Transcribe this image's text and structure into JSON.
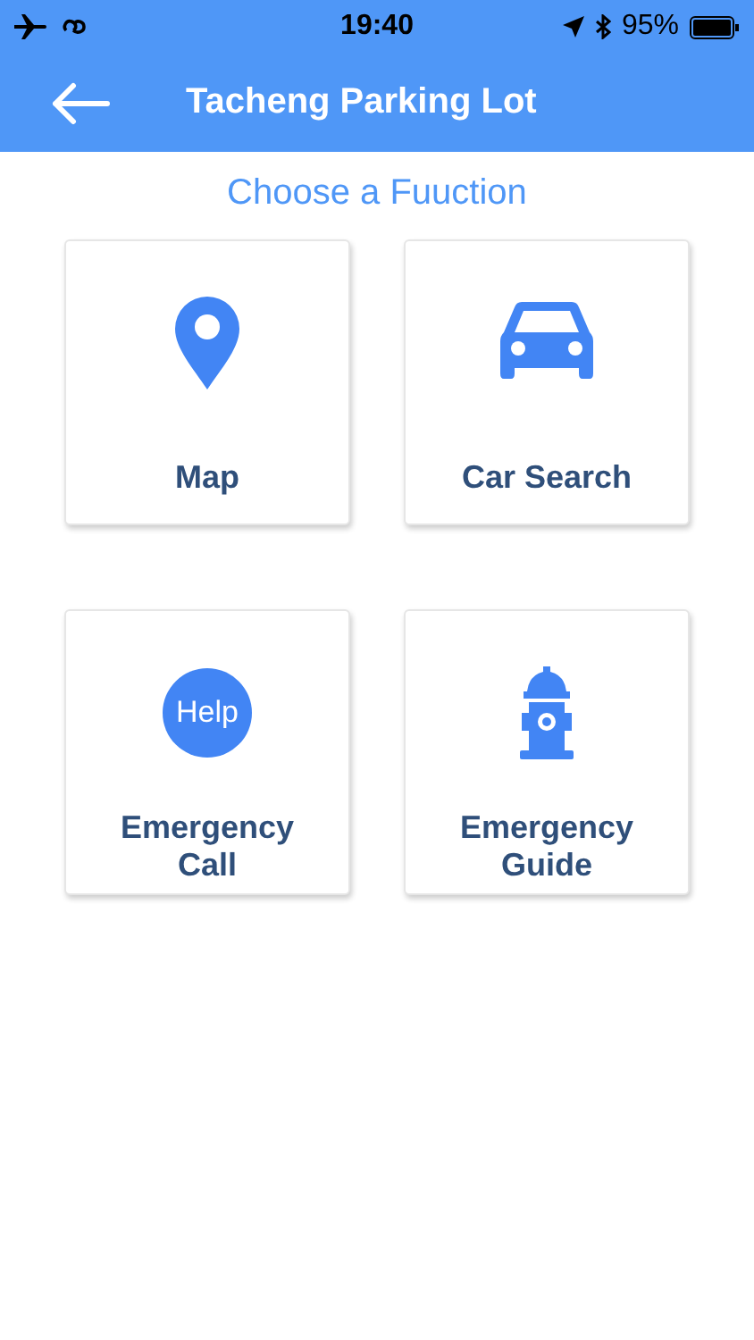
{
  "status_bar": {
    "time": "19:40",
    "battery": "95%"
  },
  "nav_bar": {
    "title": "Tacheng Parking Lot"
  },
  "heading": "Choose a Fuuction",
  "functions": [
    {
      "kind": "map",
      "label": "Map"
    },
    {
      "kind": "car",
      "label": "Car Search"
    },
    {
      "kind": "help",
      "label": "Emergency Call",
      "icon_text": "Help"
    },
    {
      "kind": "hydrant",
      "label": "Emergency Guide"
    }
  ]
}
